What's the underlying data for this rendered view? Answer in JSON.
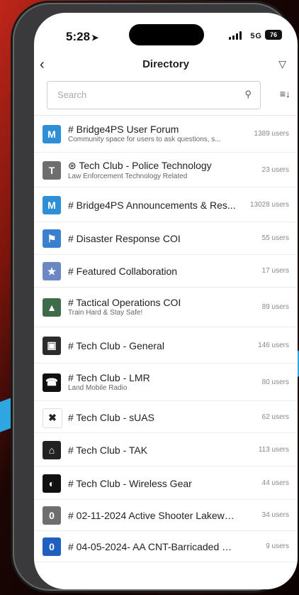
{
  "status": {
    "time": "5:28",
    "network": "5G",
    "battery": "76"
  },
  "header": {
    "title": "Directory"
  },
  "search": {
    "placeholder": "Search"
  },
  "rows": [
    {
      "name": "# Bridge4PS User Forum",
      "desc": "Community space for users to ask questions, s...",
      "count": "1389 users",
      "avatar": "M",
      "color": "#2e8fd6"
    },
    {
      "name": "⊛ Tech Club - Police Technology",
      "desc": "Law Enforcement Technology Related",
      "count": "23 users",
      "avatar": "T",
      "color": "#6e6e6e"
    },
    {
      "name": "# Bridge4PS Announcements & Res...",
      "desc": "",
      "count": "13028 users",
      "avatar": "M",
      "color": "#2e8fd6"
    },
    {
      "name": "# Disaster Response COI",
      "desc": "",
      "count": "55 users",
      "avatar": "⚑",
      "color": "#3b7fd1"
    },
    {
      "name": "# Featured Collaboration",
      "desc": "",
      "count": "17 users",
      "avatar": "★",
      "color": "#6c88c4"
    },
    {
      "name": "# Tactical Operations COI",
      "desc": "Train Hard & Stay Safe!",
      "count": "89 users",
      "avatar": "▲",
      "color": "#3e6b4a"
    },
    {
      "name": "# Tech Club - General",
      "desc": "",
      "count": "146 users",
      "avatar": "▣",
      "color": "#2b2b2b"
    },
    {
      "name": "# Tech Club - LMR",
      "desc": "Land Mobile Radio",
      "count": "80 users",
      "avatar": "☎",
      "color": "#111111"
    },
    {
      "name": "# Tech Club - sUAS",
      "desc": "",
      "count": "62 users",
      "avatar": "✖",
      "color": "#ffffff"
    },
    {
      "name": "# Tech Club - TAK",
      "desc": "",
      "count": "113 users",
      "avatar": "⌂",
      "color": "#222222"
    },
    {
      "name": "# Tech Club - Wireless Gear",
      "desc": "",
      "count": "44 users",
      "avatar": "◐",
      "color": "#111111"
    },
    {
      "name": "# 02-11-2024 Active Shooter Lakewoo...",
      "desc": "",
      "count": "34 users",
      "avatar": "0",
      "color": "#6e6e6e"
    },
    {
      "name": "# 04-05-2024- AA CNT-Barricaded Sus...",
      "desc": "",
      "count": "9 users",
      "avatar": "0",
      "color": "#1f5fbf"
    }
  ]
}
